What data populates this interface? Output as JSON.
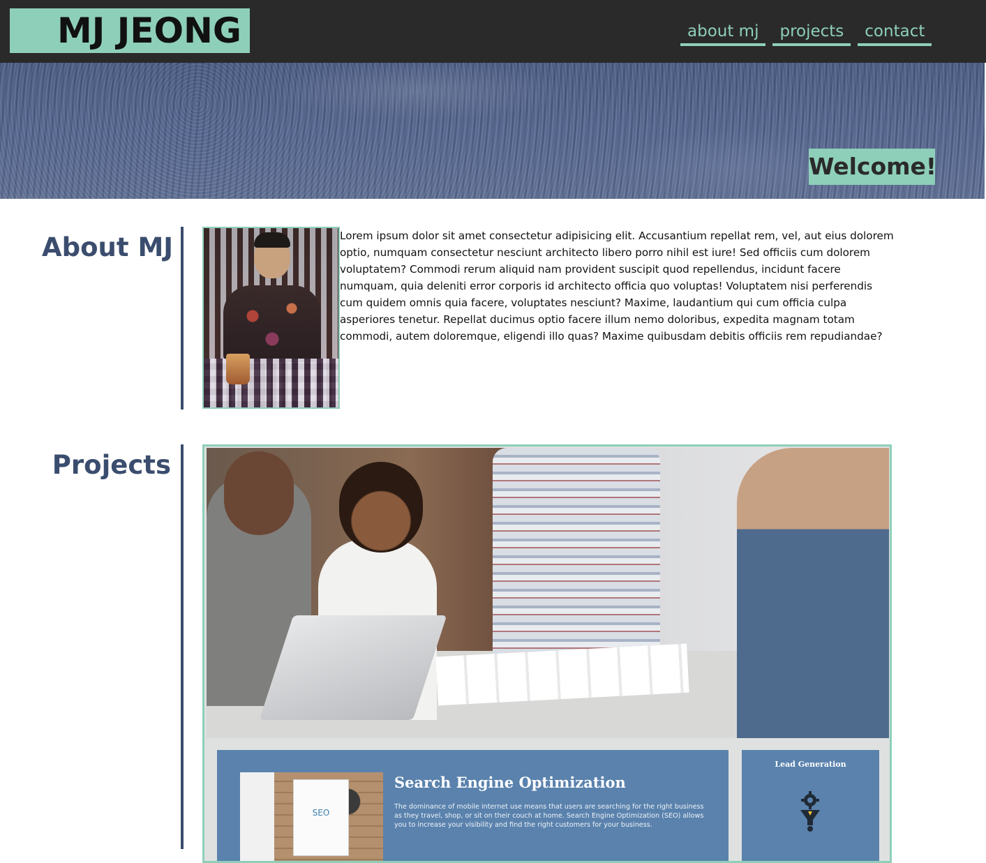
{
  "header": {
    "logo": "MJ JEONG",
    "nav": [
      {
        "label": "about mj"
      },
      {
        "label": "projects"
      },
      {
        "label": "contact"
      }
    ]
  },
  "hero": {
    "welcome": "Welcome!"
  },
  "about": {
    "heading": "About MJ",
    "text": "Lorem ipsum dolor sit amet consectetur adipisicing elit. Accusantium repellat rem, vel, aut eius dolorem optio, numquam consectetur nesciunt architecto libero porro nihil est iure! Sed officiis cum dolorem voluptatem? Commodi rerum aliquid nam provident suscipit quod repellendus, incidunt facere numquam, quia deleniti error corporis id architecto officia quo voluptas! Voluptatem nisi perferendis cum quidem omnis quia facere, voluptates nesciunt? Maxime, laudantium qui cum officia culpa asperiores tenetur. Repellat ducimus optio facere illum nemo doloribus, expedita magnam totam commodi, autem doloremque, eligendi illo quas? Maxime quibusdam debitis officiis rem repudiandae?"
  },
  "projects": {
    "heading": "Projects",
    "preview": {
      "seo_title": "Search Engine Optimization",
      "seo_description": "The dominance of mobile internet use means that users are searching for the right business as they travel, shop, or sit on their couch at home. Search Engine Optimization (SEO) allows you to increase your visibility and find the right customers for your business.",
      "seo_note": "SEO",
      "lead_title": "Lead Generation"
    }
  },
  "colors": {
    "accent": "#8ecfba",
    "header_bg": "#2a2a2a",
    "heading": "#3b4d6e",
    "panel": "#5a82ad"
  }
}
